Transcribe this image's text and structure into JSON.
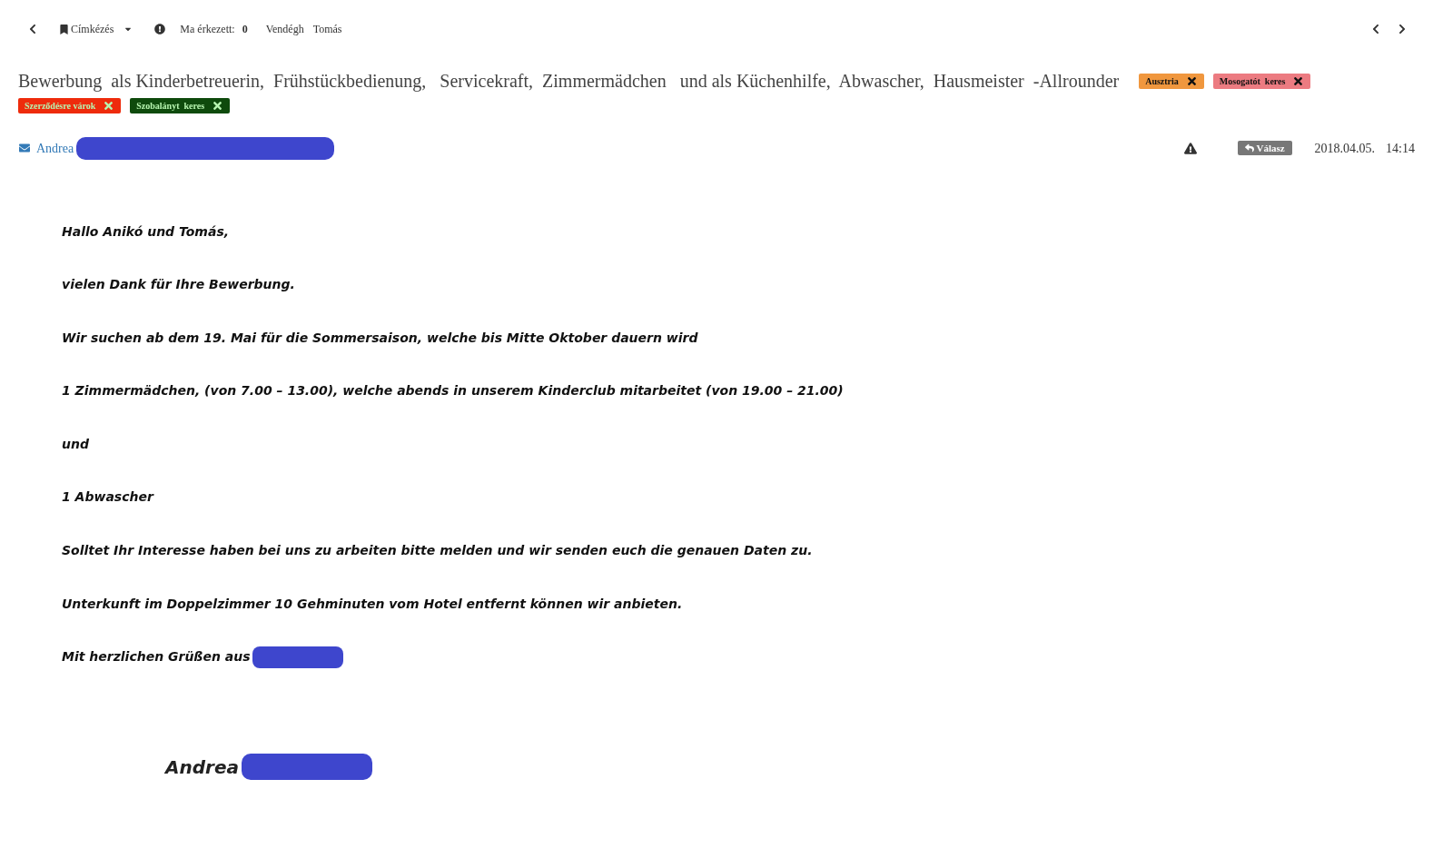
{
  "toolbar": {
    "label_menu": "Címkézés",
    "arrived_label": "Ma érkezett:",
    "arrived_count": "0",
    "guest_label": "Vendégh",
    "guest_name": "Tomás"
  },
  "subject": "Bewerbung  als Kinderbetreuerin,  Frühstückbedienung,   Servicekraft,  Zimmermädchen   und als Küchenhilfe,  Abwascher,  Hausmeister  -Allrounder",
  "tags": [
    {
      "label": "Ausztria",
      "color": "#f0973e"
    },
    {
      "label": "Mosogatót  keres",
      "color": "#ec7b81"
    },
    {
      "label": "Szerződésre várok",
      "color": "#ee2b0c"
    },
    {
      "label": "Szobalányt  keres",
      "color": "#0e4a0c"
    }
  ],
  "message": {
    "sender": "Andrea",
    "reply_button": "Válasz",
    "date": "2018.04.05.",
    "time": "14:14",
    "paragraphs": [
      "Hallo Anikó und Tomás,",
      "vielen Dank für Ihre Bewerbung.",
      "Wir suchen ab dem 19. Mai für die Sommersaison, welche bis Mitte Oktober dauern wird",
      "1 Zimmermädchen, (von 7.00 – 13.00), welche abends in unserem Kinderclub mitarbeitet (von 19.00 – 21.00)",
      "und",
      "1 Abwascher",
      "Solltet Ihr Interesse haben bei uns zu arbeiten bitte melden und wir senden euch die genauen Daten zu.",
      "Unterkunft im Doppelzimmer 10 Gehminuten vom Hotel entfernt können wir anbieten.",
      "Mit herzlichen Grüßen aus"
    ],
    "signature": "Andrea"
  }
}
